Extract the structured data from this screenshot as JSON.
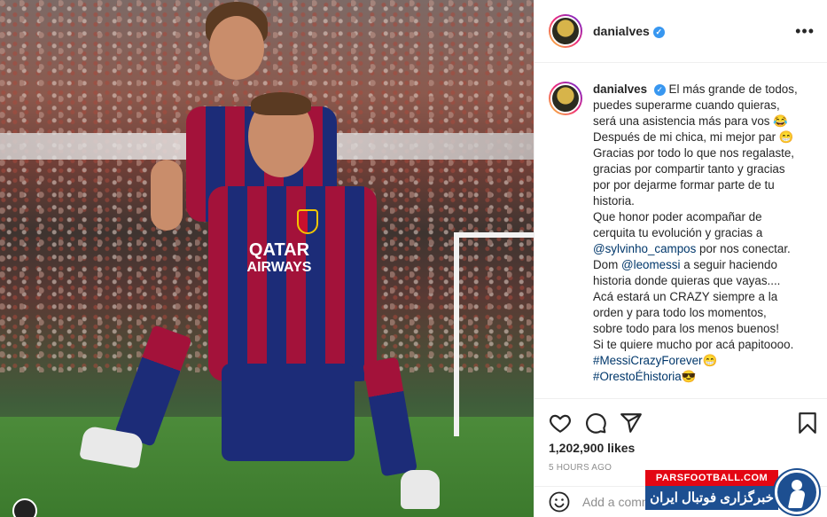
{
  "post": {
    "username": "danialves",
    "verified": true,
    "more_label": "•••"
  },
  "photo": {
    "shirt_sponsor_line1": "QATAR",
    "shirt_sponsor_line2": "AIRWAYS"
  },
  "caption": {
    "username": "danialves",
    "lines": [
      "El más grande de todos,",
      "puedes superarme cuando quieras,",
      "será una asistencia más para vos 😂",
      "Después de mi chica, mi mejor par 😁",
      "Gracias por todo lo que nos regalaste,",
      "gracias por compartir tanto y gracias",
      "por por dejarme formar parte de tu",
      "historia.",
      "Que honor poder acompañar de",
      "cerquita tu evolución y gracias a",
      "por nos conectar.",
      "Dom",
      "a seguir haciendo",
      "historia donde quieras que vayas....",
      "Acá estará un CRAZY siempre a la",
      "orden y para todo los momentos,",
      "sobre todo para los menos buenos!",
      "Si te quiere mucho por acá papitoooo."
    ],
    "mention_1": "@sylvinho_campos",
    "mention_2": "@leomessi",
    "hashtag_1": "#MessiCrazyForever",
    "hashtag_1_emoji": "😁",
    "hashtag_2": "#OrestoÉhistoria",
    "hashtag_2_emoji": "😎"
  },
  "actions": {
    "like_icon": "heart-icon",
    "comment_icon": "comment-icon",
    "share_icon": "paper-plane-icon",
    "save_icon": "bookmark-icon"
  },
  "stats": {
    "likes": "1,202,900 likes",
    "time_ago": "5 HOURS AGO"
  },
  "comment": {
    "placeholder": "Add a comment..."
  },
  "watermark": {
    "site": "PARSFOOTBALL.COM",
    "tagline": "خبرگزاری فوتبال ایران"
  },
  "colors": {
    "link": "#00376b",
    "verified": "#3897f0",
    "muted": "#8e8e8e"
  }
}
